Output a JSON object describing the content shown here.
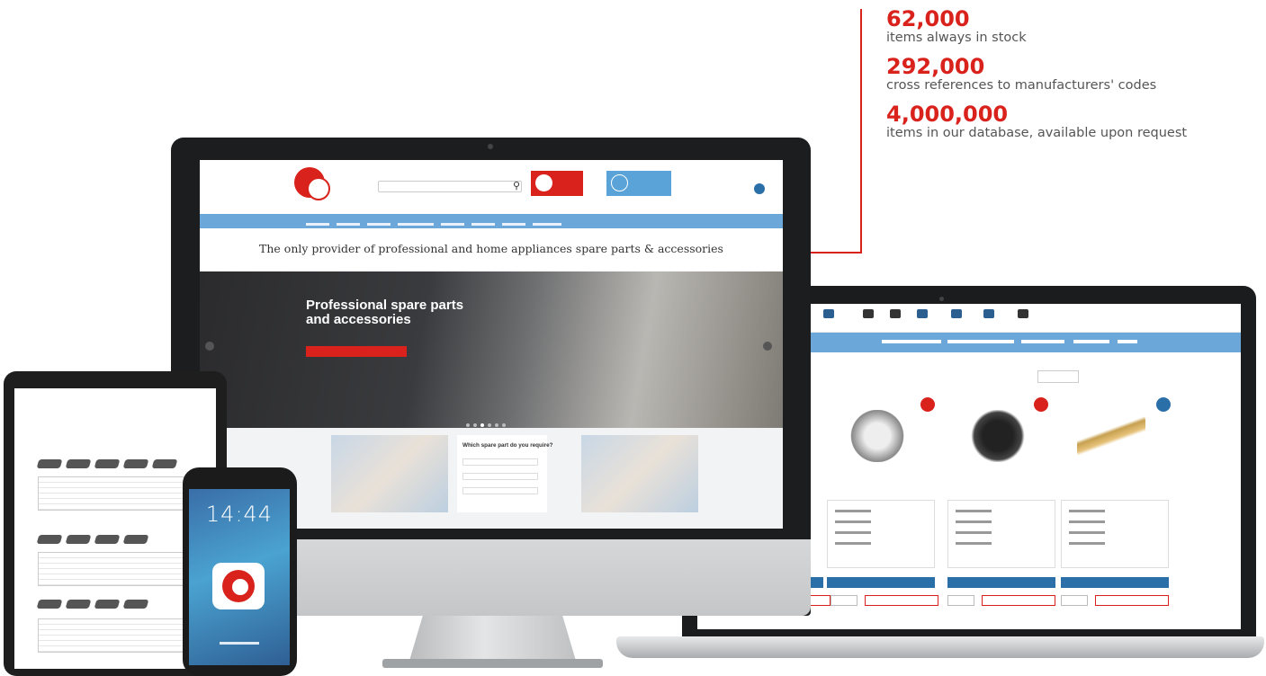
{
  "stats": [
    {
      "number": "62,000",
      "label": "items always in stock"
    },
    {
      "number": "292,000",
      "label": "cross references to manufacturers' codes"
    },
    {
      "number": "4,000,000",
      "label": "items in our database, available upon request"
    }
  ],
  "desktop_site": {
    "tagline": "The only provider of professional and home appliances spare parts & accessories",
    "hero_title_line1": "Professional spare parts",
    "hero_title_line2": "and accessories",
    "form_title": "Which spare part do you require?"
  },
  "phone": {
    "time": "14:44"
  },
  "colors": {
    "accent_red": "#d9221c",
    "nav_blue": "#6ba7d9",
    "button_blue": "#2b6fa8",
    "stat_label_gray": "#555555"
  },
  "icons": {
    "search": "search-icon",
    "logo": "brand-logo-icon",
    "user": "user-icon"
  }
}
